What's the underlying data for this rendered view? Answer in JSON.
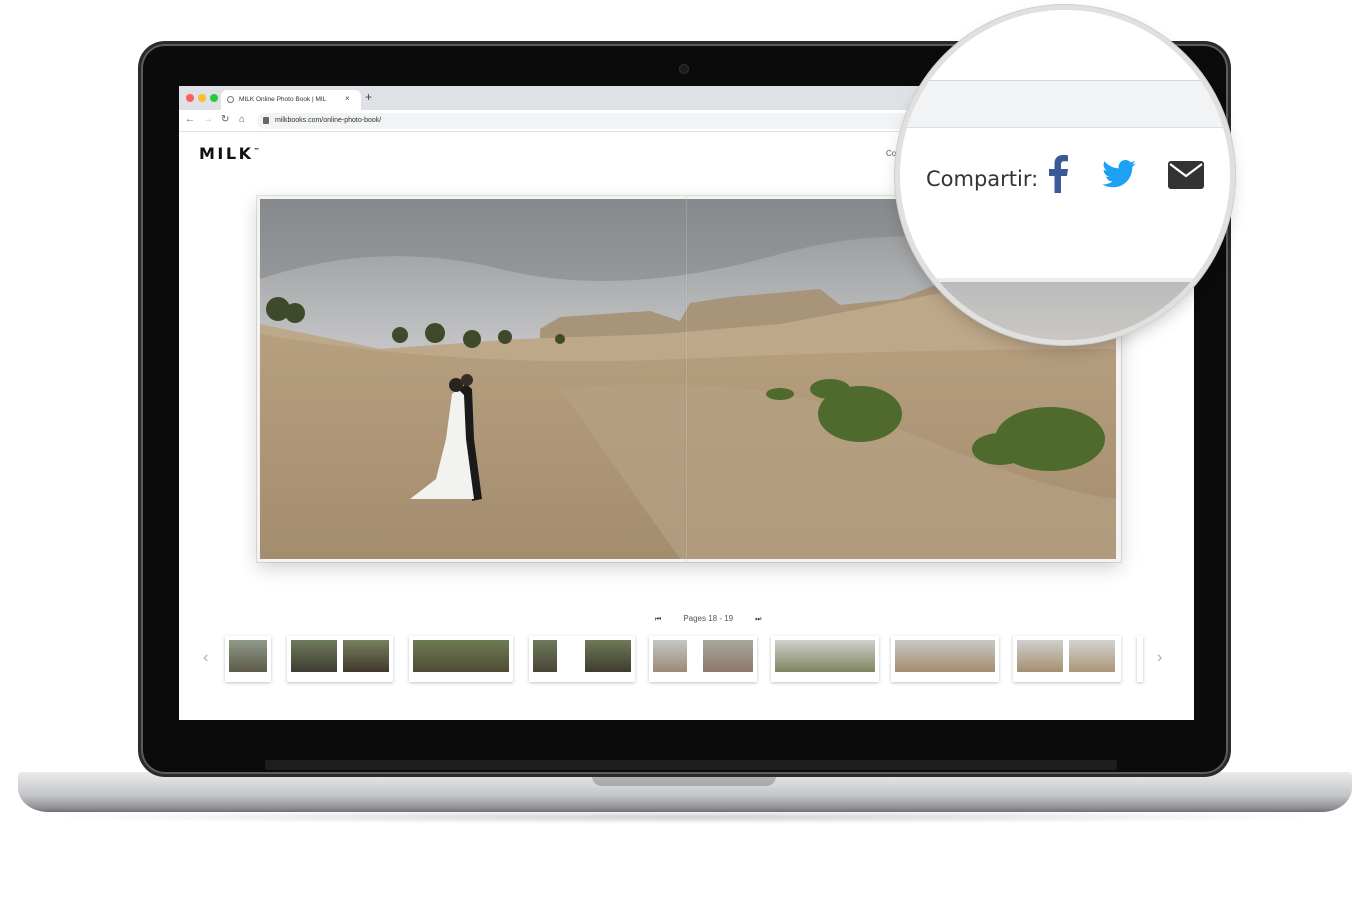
{
  "browser": {
    "tab_title": "MILK Online Photo Book | MIL",
    "tab_close": "×",
    "new_tab": "+",
    "url": "milkbooks.com/online-photo-book/",
    "nav": {
      "back": "←",
      "forward": "→",
      "reload": "↻",
      "home": "⌂"
    },
    "traffic_lights": {
      "close": "#ff5f57",
      "minimize": "#febc2e",
      "maximize": "#28c840"
    }
  },
  "page": {
    "logo": "MILK",
    "logo_tm": "™",
    "share_label_small": "Com",
    "pager": {
      "first": "⏮",
      "label": "Pages 18 - 19",
      "last": "⏭"
    },
    "prev_arrow": "‹",
    "next_arrow": "›"
  },
  "magnifier": {
    "share_label": "Compartir:",
    "icons": [
      "facebook-icon",
      "twitter-icon",
      "mail-icon"
    ],
    "colors": {
      "facebook": "#3b5998",
      "twitter": "#1da1f2",
      "mail": "#333333"
    }
  }
}
